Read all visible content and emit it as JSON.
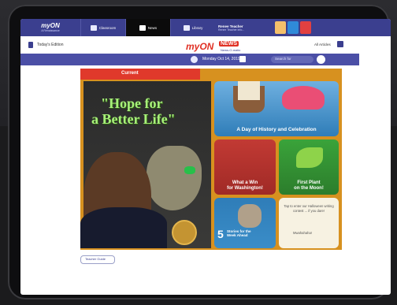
{
  "nav": {
    "logo": "myON",
    "logo_sub": "A Renaissance",
    "items": [
      {
        "label": "Classroom"
      },
      {
        "label": "News"
      },
      {
        "label": "Library"
      }
    ],
    "user_name": "Renee Teacher",
    "user_email": "Renee Teacher info..."
  },
  "edition": {
    "label": "Today's Edition",
    "brand_my": "myON",
    "brand_news": "NEWS",
    "brand_tag": "News-O-matic",
    "all_articles": "All Articles"
  },
  "datebar": {
    "date": "Monday Oct 14, 2019",
    "search_placeholder": "Search for"
  },
  "content": {
    "section": "Current",
    "hero_line1": "\"Hope for",
    "hero_line2": "a Better Life\"",
    "tiles": [
      {
        "caption": "A Day of History and Celebration"
      },
      {
        "caption_l1": "What a Win",
        "caption_l2": "for Washington!"
      },
      {
        "caption_l1": "First Plant",
        "caption_l2": "on the Moon!"
      },
      {
        "num": "5",
        "label": "Stories for the Week Ahead"
      },
      {
        "msg": "Tap to enter our Halloween writing contest ... if you dare!",
        "sig": "Mwahahaha!"
      }
    ]
  },
  "footer": {
    "label": "Teacher Guide"
  },
  "colors": {
    "nav": "#3b3f8f",
    "accent": "#e03024",
    "content_bg": "#d7911f"
  }
}
